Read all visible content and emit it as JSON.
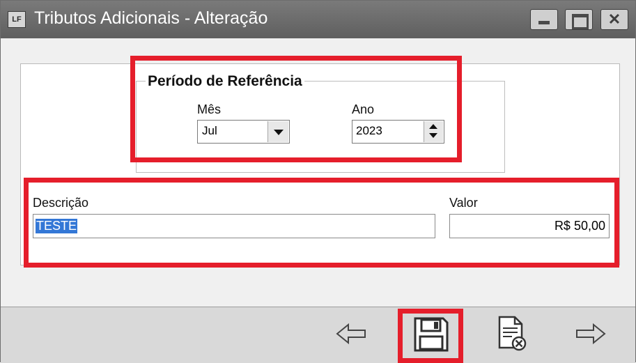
{
  "window": {
    "app_icon_text": "LF",
    "title": "Tributos Adicionais - Alteração"
  },
  "group": {
    "title": "Período de Referência",
    "month_label": "Mês",
    "month_value": "Jul",
    "year_label": "Ano",
    "year_value": "2023"
  },
  "fields": {
    "descricao_label": "Descrição",
    "descricao_value": "TESTE",
    "valor_label": "Valor",
    "valor_value": "R$ 50,00"
  },
  "toolbar": {
    "buttons": [
      {
        "name": "previous",
        "icon": "arrow-left-icon"
      },
      {
        "name": "save",
        "icon": "floppy-disk-icon"
      },
      {
        "name": "cancel",
        "icon": "document-cancel-icon"
      },
      {
        "name": "next",
        "icon": "arrow-right-icon"
      }
    ]
  },
  "colors": {
    "highlight": "#e51e2b",
    "title_bar": "#6e6e6e",
    "selection": "#3377d6"
  }
}
